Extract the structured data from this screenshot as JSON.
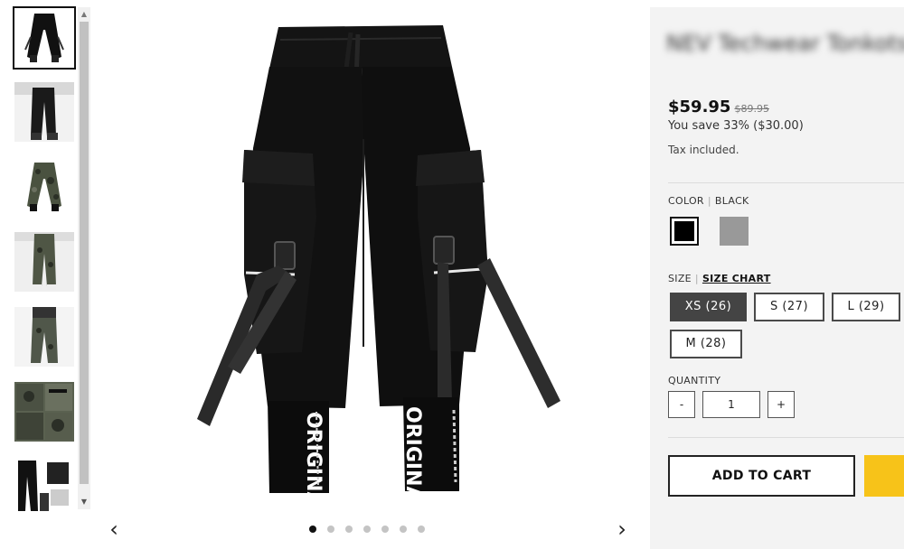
{
  "colors": {
    "panel_bg": "#f3f3f3",
    "accent_yellow": "#f7c319",
    "selected_size_bg": "#444444"
  },
  "gallery": {
    "thumbnails": [
      {
        "name": "black-pants-flat",
        "selected": true
      },
      {
        "name": "model-wearing-black"
      },
      {
        "name": "camo-pants-flat"
      },
      {
        "name": "model-wearing-camo"
      },
      {
        "name": "model-wearing-camo-2"
      },
      {
        "name": "camo-detail-collage"
      },
      {
        "name": "black-pants-collage"
      }
    ],
    "prev_icon": "‹",
    "next_icon": "›",
    "slide_count": 7,
    "active_slide": 1,
    "main_image_text": {
      "left_leg": "ORIGINAL",
      "right_leg": "ORIGINAL"
    }
  },
  "product": {
    "title": "NEV Techwear Tonkotsu Combat Cargo pants",
    "price": "$59.95",
    "compare_price": "$89.95",
    "savings": "You save 33% ($30.00)",
    "tax_note": "Tax included."
  },
  "options": {
    "color_label": "COLOR",
    "color_value": "BLACK",
    "color_swatches": [
      {
        "name": "Black",
        "hex": "#000000",
        "selected": true
      },
      {
        "name": "Gray",
        "hex": "#999999",
        "selected": false
      }
    ],
    "size_label": "SIZE",
    "size_chart_label": "SIZE CHART",
    "sizes": [
      {
        "label": "XS (26)",
        "selected": true
      },
      {
        "label": "S (27)"
      },
      {
        "label": "L (29)"
      },
      {
        "label": "M (28)"
      }
    ]
  },
  "quantity": {
    "label": "QUANTITY",
    "minus": "-",
    "value": "1",
    "plus": "+"
  },
  "actions": {
    "add_to_cart": "ADD TO CART"
  }
}
